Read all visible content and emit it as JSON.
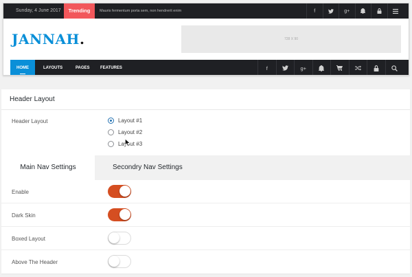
{
  "preview": {
    "topbar": {
      "date": "Sunday, 4 June 2017",
      "trending_label": "Trending",
      "ticker_text": "Mauris fermentum porta sem, non hendrerit enim",
      "icons": [
        "f",
        "t",
        "g+",
        "bell",
        "lock",
        "menu"
      ]
    },
    "logo": {
      "text": "JANNAH",
      "dot": "."
    },
    "ad": {
      "size_text": "728 X 90"
    },
    "nav": {
      "items": [
        "HOME",
        "LAYOUTS",
        "PAGES",
        "FEATURES"
      ],
      "active_index": 0,
      "icons": [
        "f",
        "t",
        "g+",
        "bell",
        "cart",
        "shuffle",
        "lock",
        "search"
      ]
    },
    "colors": {
      "accent": "#0a8fd8",
      "trending": "#f2575b",
      "dark": "#1f2024"
    }
  },
  "settings": {
    "section_title": "Header Layout",
    "header_layout": {
      "label": "Header Layout",
      "options": [
        "Layout #1",
        "Layout #2",
        "Layout #3"
      ],
      "selected_index": 0
    },
    "tabs": {
      "main": "Main Nav Settings",
      "secondary": "Secondry Nav Settings",
      "active": "main"
    },
    "switches": [
      {
        "label": "Enable",
        "on": true
      },
      {
        "label": "Dark Skin",
        "on": true
      },
      {
        "label": "Boxed Layout",
        "on": false
      },
      {
        "label": "Above The Header",
        "on": false
      }
    ],
    "colors": {
      "toggle_on": "#d54e21"
    }
  }
}
